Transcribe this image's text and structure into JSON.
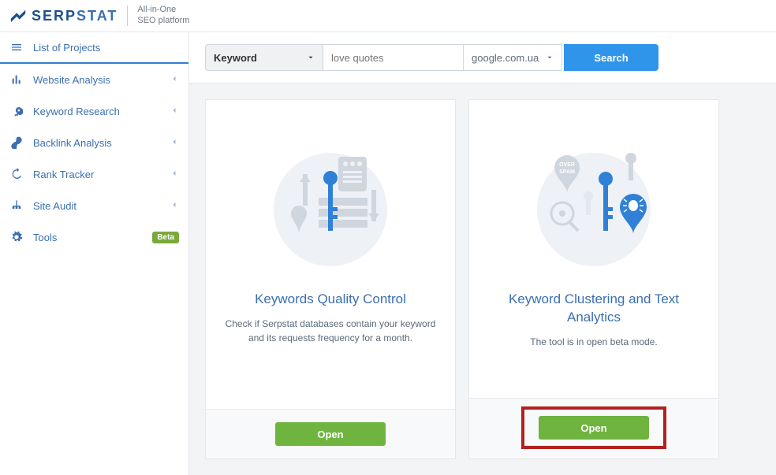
{
  "header": {
    "brand_a": "SERP",
    "brand_b": "STAT",
    "tagline_line1": "All-in-One",
    "tagline_line2": "SEO platform"
  },
  "sidebar": {
    "items": [
      {
        "label": "List of Projects",
        "icon": "menu-icon"
      },
      {
        "label": "Website Analysis",
        "icon": "analysis-icon"
      },
      {
        "label": "Keyword Research",
        "icon": "key-icon"
      },
      {
        "label": "Backlink Analysis",
        "icon": "link-icon"
      },
      {
        "label": "Rank Tracker",
        "icon": "history-icon"
      },
      {
        "label": "Site Audit",
        "icon": "sitemap-icon"
      },
      {
        "label": "Tools",
        "icon": "gear-icon",
        "badge": "Beta"
      }
    ]
  },
  "search": {
    "type_label": "Keyword",
    "placeholder": "love quotes",
    "domain_label": "google.com.ua",
    "button_label": "Search"
  },
  "cards": [
    {
      "title": "Keywords Quality Control",
      "desc": "Check if Serpstat databases contain your keyword and its requests frequency for a month.",
      "open_label": "Open"
    },
    {
      "title": "Keyword Clustering and Text Analytics",
      "desc": "The tool is in open beta mode.",
      "open_label": "Open"
    }
  ]
}
